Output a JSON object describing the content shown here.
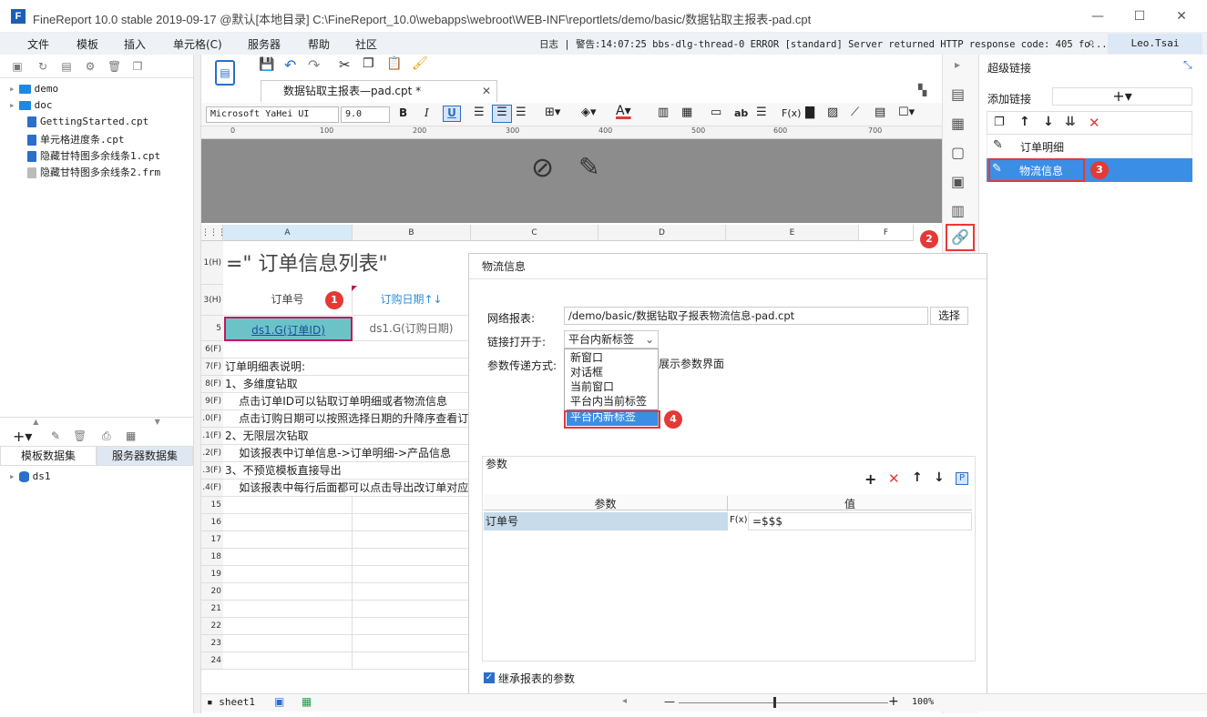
{
  "window": {
    "title": "FineReport 10.0 stable 2019-09-17 @默认[本地目录]     C:\\FineReport_10.0\\webapps\\webroot\\WEB-INF\\reportlets/demo/basic/数据钻取主报表-pad.cpt",
    "minimize": "—",
    "maximize": "☐",
    "close": "✕"
  },
  "menu": [
    "文件",
    "模板",
    "插入",
    "单元格(C)",
    "服务器",
    "帮助",
    "社区"
  ],
  "log_text": "日志 | 警告:14:07:25 bbs-dlg-thread-0 ERROR [standard] Server returned HTTP response code: 405 fo...",
  "user": "Leo.Tsai",
  "tree": [
    {
      "name": "demo",
      "type": "folder"
    },
    {
      "name": "doc",
      "type": "folder"
    },
    {
      "name": "GettingStarted.cpt",
      "type": "file"
    },
    {
      "name": "单元格进度条.cpt",
      "type": "file"
    },
    {
      "name": "隐藏甘特图多余线条1.cpt",
      "type": "file"
    },
    {
      "name": "隐藏甘特图多余线条2.frm",
      "type": "file"
    }
  ],
  "dataset_tabs": [
    "模板数据集",
    "服务器数据集"
  ],
  "datasets": [
    "ds1"
  ],
  "tab_title": "数据钻取主报表—pad.cpt *",
  "format": {
    "font": "Microsoft YaHei UI",
    "size": "9.0"
  },
  "ruler": [
    "0",
    "100",
    "200",
    "300",
    "400",
    "500",
    "600",
    "700"
  ],
  "columns": [
    "A",
    "B",
    "C",
    "D",
    "E",
    "F"
  ],
  "rows": [
    {
      "h": "1(H)",
      "a": "=\" 订单信息列表\"",
      "b": ""
    },
    {
      "h": "3(H)",
      "a": "订单号",
      "b": "订购日期↑↓"
    },
    {
      "h": "5",
      "a": "ds1.G(订单ID)",
      "b": "ds1.G(订购日期)"
    },
    {
      "h": "6(F)",
      "a": "",
      "b": ""
    },
    {
      "h": "7(F)",
      "a": "订单明细表说明:",
      "b": ""
    },
    {
      "h": "8(F)",
      "a": "1、多维度钻取",
      "b": ""
    },
    {
      "h": "9(F)",
      "a": "    点击订单ID可以钻取订单明细或者物流信息",
      "b": ""
    },
    {
      "h": ".0(F)",
      "a": "    点击订购日期可以按照选择日期的升降序查看订",
      "b": ""
    },
    {
      "h": ".1(F)",
      "a": "2、无限层次钻取",
      "b": ""
    },
    {
      "h": ".2(F)",
      "a": "    如该报表中订单信息->订单明细->产品信息",
      "b": ""
    },
    {
      "h": ".3(F)",
      "a": "3、不预览模板直接导出",
      "b": ""
    },
    {
      "h": ".4(F)",
      "a": "    如该报表中每行后面都可以点击导出改订单对应",
      "b": ""
    },
    {
      "h": "15",
      "a": "",
      "b": ""
    },
    {
      "h": "16",
      "a": "",
      "b": ""
    },
    {
      "h": "17",
      "a": "",
      "b": ""
    },
    {
      "h": "18",
      "a": "",
      "b": ""
    },
    {
      "h": "19",
      "a": "",
      "b": ""
    },
    {
      "h": "20",
      "a": "",
      "b": ""
    },
    {
      "h": "21",
      "a": "",
      "b": ""
    },
    {
      "h": "22",
      "a": "",
      "b": ""
    },
    {
      "h": "23",
      "a": "",
      "b": ""
    },
    {
      "h": "24",
      "a": "",
      "b": ""
    }
  ],
  "right_panel": {
    "title": "超级链接",
    "add_label": "添加链接",
    "items": [
      "订单明细",
      "物流信息"
    ]
  },
  "dialog": {
    "title": "物流信息",
    "report_label": "网络报表:",
    "report_path": "/demo/basic/数据钻取子报表物流信息-pad.cpt",
    "select_button": "选择",
    "open_label": "链接打开于:",
    "open_value": "平台内新标签",
    "param_label": "参数传递方式:",
    "show_param": "展示参数界面",
    "options": [
      "新窗口",
      "对话框",
      "当前窗口",
      "平台内当前标签",
      "平台内新标签"
    ],
    "params_title": "参数",
    "param_headers": [
      "参数",
      "值"
    ],
    "param_row": {
      "name": "订单号",
      "value": "=$$$"
    },
    "inherit": "继承报表的参数"
  },
  "badges": [
    "1",
    "2",
    "3",
    "4"
  ],
  "sheet": "sheet1",
  "zoom": "100%"
}
